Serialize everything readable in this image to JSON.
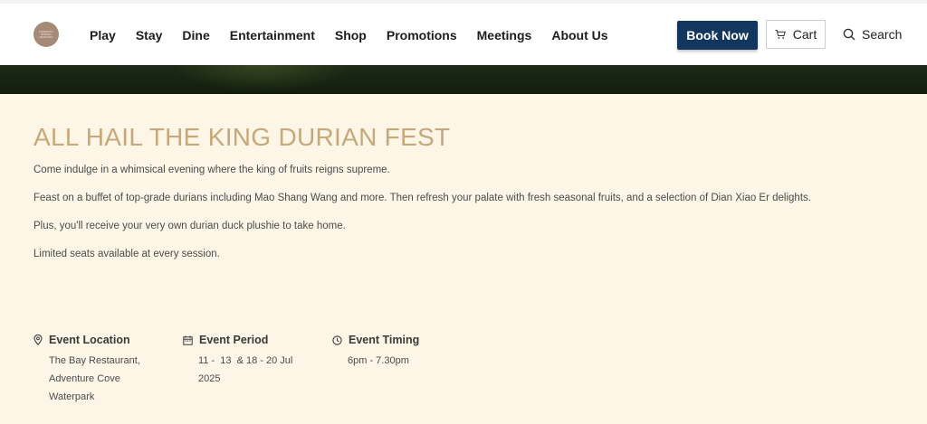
{
  "header": {
    "logo_text": "RESORTS WORLD SENTOSA",
    "nav": [
      "Play",
      "Stay",
      "Dine",
      "Entertainment",
      "Shop",
      "Promotions",
      "Meetings",
      "About Us"
    ],
    "book_label": "Book Now",
    "cart_label": "Cart",
    "search_label": "Search"
  },
  "event": {
    "title": "ALL HAIL THE KING DURIAN FEST",
    "paragraphs": [
      "Come indulge in a whimsical evening where the king of fruits reigns supreme.",
      "Feast on a buffet of top-grade durians including Mao Shang Wang and more. Then refresh your palate with fresh seasonal fruits, and a selection of Dian Xiao Er delights.",
      "Plus, you'll receive your very own durian duck plushie to take home.",
      "Limited seats available at every session."
    ],
    "location": {
      "heading": "Event Location",
      "lines": [
        "The Bay Restaurant,",
        "Adventure Cove",
        "Waterpark"
      ]
    },
    "period": {
      "heading": "Event Period",
      "lines": [
        "11 -  13  & 18 - 20 Jul",
        "2025"
      ]
    },
    "timing": {
      "heading": "Event Timing",
      "lines": [
        "6pm - 7.30pm"
      ]
    }
  },
  "colors": {
    "accent": "#c6a97a",
    "button": "#13365f",
    "background": "#fdf6e7",
    "hero": "#1a2613"
  }
}
